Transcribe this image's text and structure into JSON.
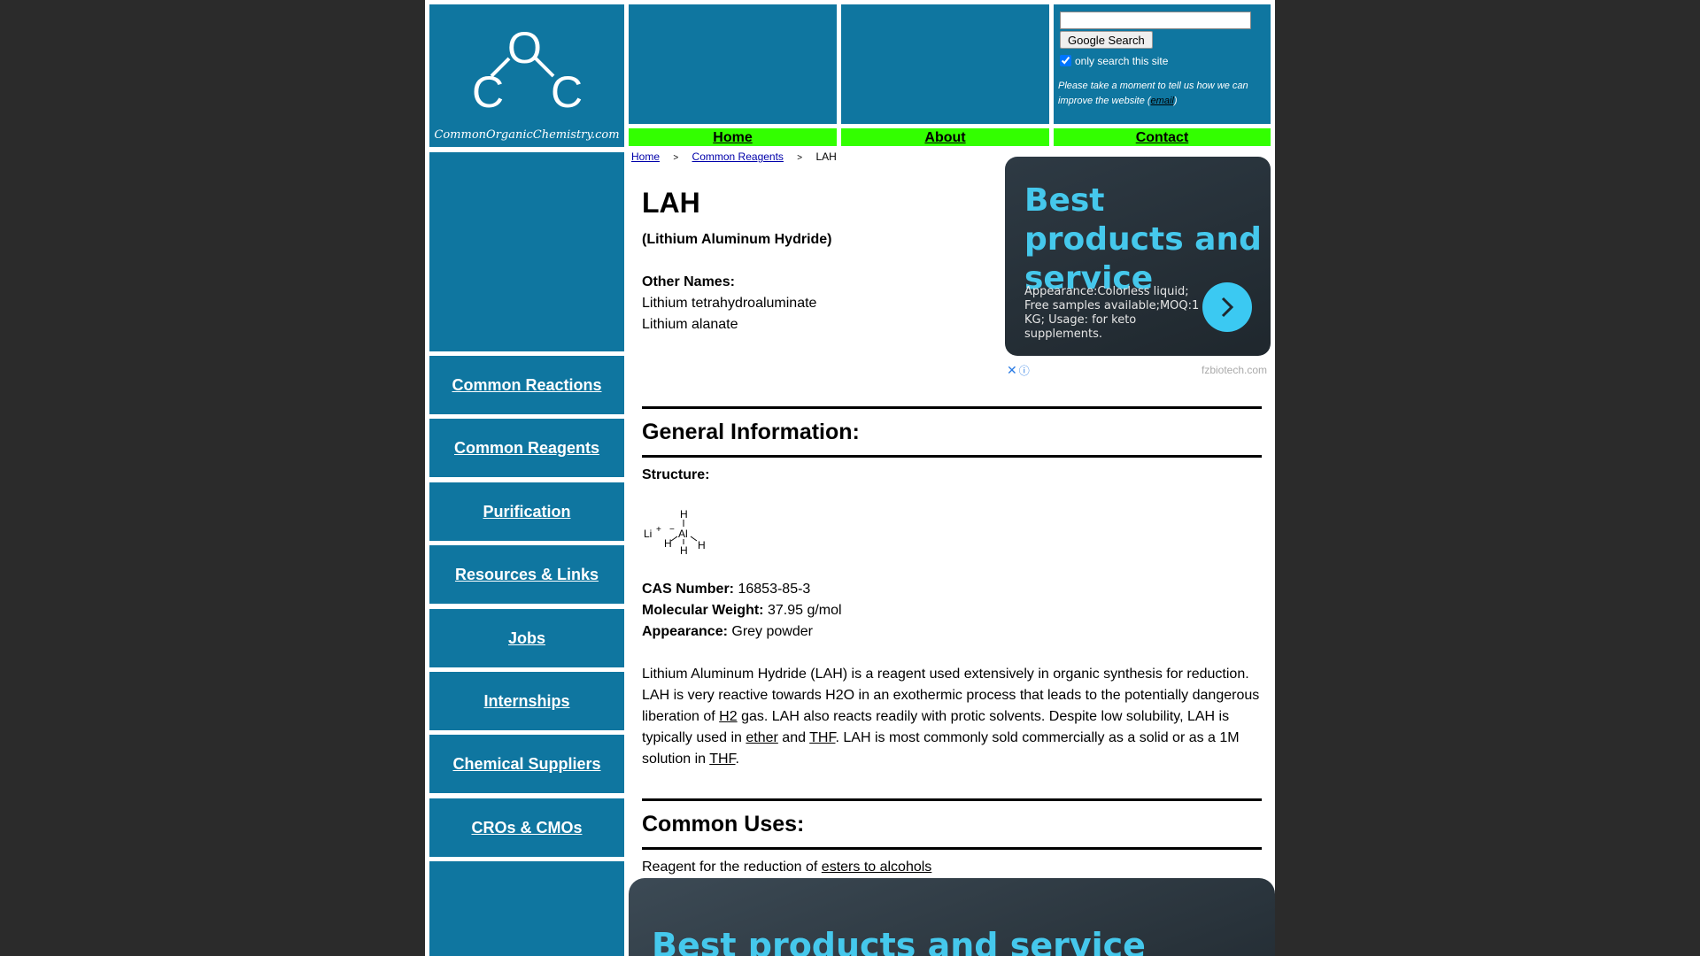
{
  "site": {
    "name": "CommonOrganicChemistry.com",
    "logo_letters": [
      "C",
      "O",
      "C"
    ]
  },
  "search": {
    "button_label": "Google Search",
    "checkbox_label": "only search this site",
    "feedback_text": "Please take a moment to tell us how we can improve the website (",
    "feedback_link": "email",
    "feedback_close": ")"
  },
  "topnav": {
    "home": "Home",
    "about": "About",
    "contact": "Contact"
  },
  "sidebar": {
    "items": [
      {
        "label": "Common Reactions"
      },
      {
        "label": "Common Reagents"
      },
      {
        "label": "Purification"
      },
      {
        "label": "Resources & Links"
      },
      {
        "label": "Jobs"
      },
      {
        "label": "Internships"
      },
      {
        "label": "Chemical Suppliers"
      },
      {
        "label": "CROs & CMOs"
      }
    ]
  },
  "breadcrumb": {
    "home": "Home",
    "sep": ">",
    "reagents": "Common Reagents",
    "current": "LAH"
  },
  "reagent": {
    "title": "LAH",
    "full_name": "(Lithium Aluminum Hydride)",
    "other_names_label": "Other Names:",
    "other_names": [
      "Lithium tetrahydroaluminate",
      "Lithium alanate"
    ],
    "general_info_heading": "General Information:",
    "structure_label": "Structure:",
    "structure_atoms": {
      "li": "Li",
      "plus": "+",
      "minus": "−",
      "al": "Al",
      "h": "H"
    },
    "cas_label": "CAS Number:",
    "cas": "16853-85-3",
    "mw_label": "Molecular Weight:",
    "mw": "37.95 g/mol",
    "appearance_label": "Appearance:",
    "appearance": "Grey powder",
    "description": {
      "p1": "Lithium Aluminum Hydride (LAH) is a reagent used extensively in organic synthesis for reduction. LAH is very reactive towards H2O in an exothermic process that leads to the potentially dangerous liberation of ",
      "link_h2": "H2",
      "p2": " gas. LAH also reacts readily with protic solvents. Despite low solubility, LAH is typically used in ",
      "link_ether": "ether",
      "p3": " and ",
      "link_thf1": "THF",
      "p4": ". LAH is most commonly sold commercially as a solid or as a 1M solution in ",
      "link_thf2": "THF",
      "p5": "."
    },
    "uses_heading": "Common Uses:",
    "uses_text": "Reagent for the reduction of ",
    "uses_link": "esters to alcohols"
  },
  "ad": {
    "headline": "Best products and service",
    "description": "Appearance:Colorless liquid; Free samples available;MOQ:1 KG; Usage: for keto supplements.",
    "close_symbol": "✕",
    "info_symbol": "ⓘ",
    "domain": "fzbiotech.com",
    "bottom_headline": "Best products and service"
  },
  "colors": {
    "panel_blue": "#0f76a0",
    "nav_green": "#33ff00",
    "ad_accent": "#45c8ec"
  }
}
